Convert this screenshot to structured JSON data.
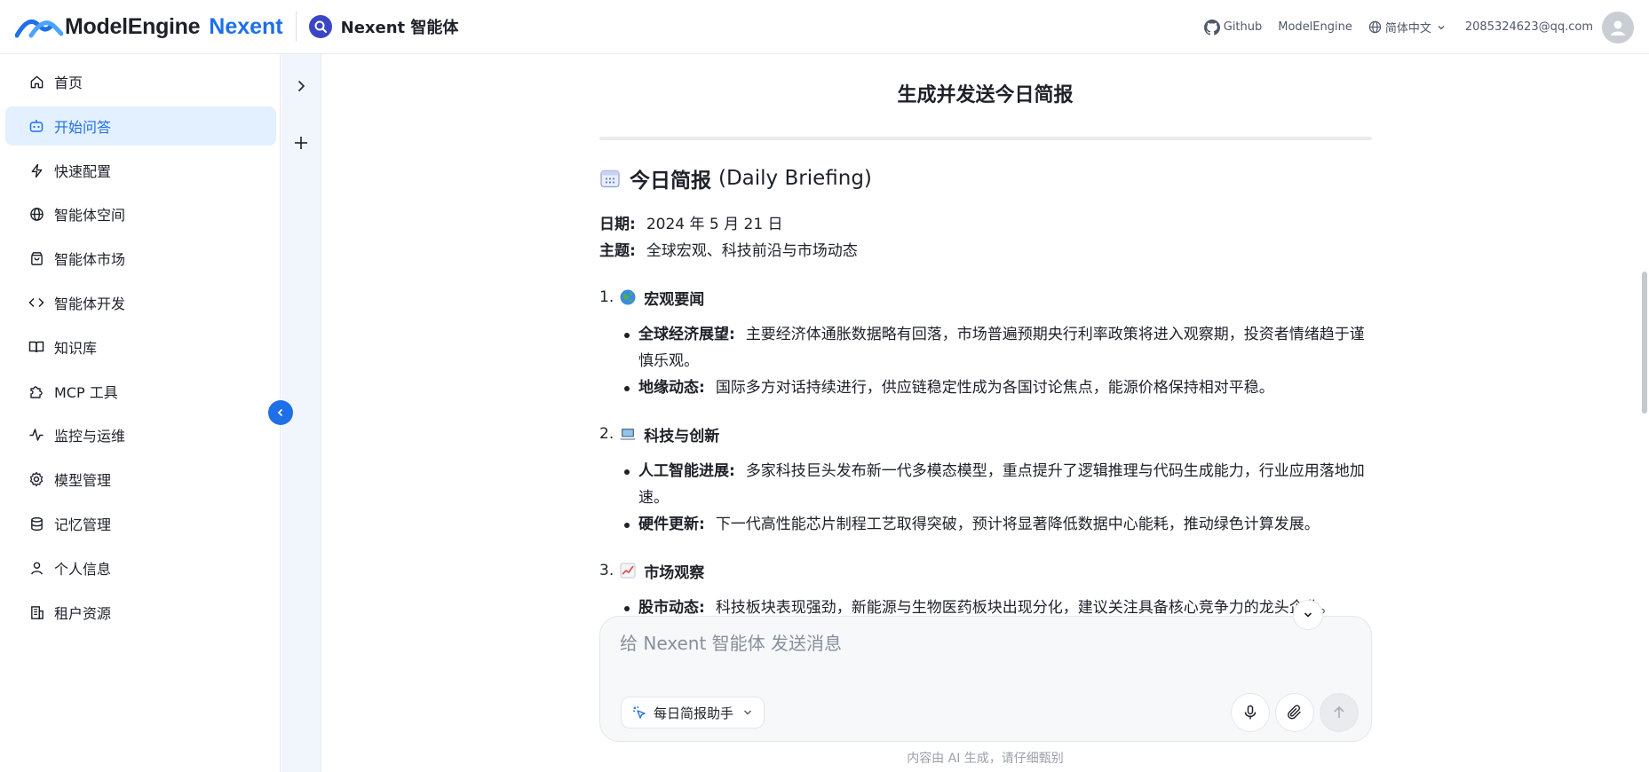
{
  "header": {
    "brand_name": "ModelEngine",
    "brand_accent": "Nexent",
    "app_title": "Nexent 智能体",
    "github_label": "Github",
    "modelengine_label": "ModelEngine",
    "language_label": "简体中文",
    "user_email": "2085324623@qq.com"
  },
  "sidebar": {
    "items": [
      {
        "label": "首页",
        "icon": "home-icon"
      },
      {
        "label": "开始问答",
        "icon": "robot-icon",
        "active": true
      },
      {
        "label": "快速配置",
        "icon": "lightning-icon"
      },
      {
        "label": "智能体空间",
        "icon": "globe-icon"
      },
      {
        "label": "智能体市场",
        "icon": "shopping-bag-icon"
      },
      {
        "label": "智能体开发",
        "icon": "code-icon"
      },
      {
        "label": "知识库",
        "icon": "book-icon"
      },
      {
        "label": "MCP 工具",
        "icon": "puzzle-icon"
      },
      {
        "label": "监控与运维",
        "icon": "activity-icon"
      },
      {
        "label": "模型管理",
        "icon": "gear-icon"
      },
      {
        "label": "记忆管理",
        "icon": "database-icon"
      },
      {
        "label": "个人信息",
        "icon": "user-icon"
      },
      {
        "label": "租户资源",
        "icon": "building-icon"
      }
    ]
  },
  "chat": {
    "title": "生成并发送今日简报",
    "briefing_title": "今日简报",
    "briefing_subtitle": "(Daily Briefing)",
    "date_label": "日期:",
    "date_value": "2024 年 5 月 21 日",
    "topic_label": "主题:",
    "topic_value": "全球宏观、科技前沿与市场动态",
    "sections": [
      {
        "number": "1.",
        "icon": "globe-emoji",
        "title": "宏观要闻",
        "bullets": [
          {
            "label": "全球经济展望:",
            "text": "主要经济体通胀数据略有回落，市场普遍预期央行利率政策将进入观察期，投资者情绪趋于谨慎乐观。"
          },
          {
            "label": "地缘动态:",
            "text": "国际多方对话持续进行，供应链稳定性成为各国讨论焦点，能源价格保持相对平稳。"
          }
        ]
      },
      {
        "number": "2.",
        "icon": "laptop-emoji",
        "title": "科技与创新",
        "bullets": [
          {
            "label": "人工智能进展:",
            "text": "多家科技巨头发布新一代多模态模型，重点提升了逻辑推理与代码生成能力，行业应用落地加速。"
          },
          {
            "label": "硬件更新:",
            "text": "下一代高性能芯片制程工艺取得突破，预计将显著降低数据中心能耗，推动绿色计算发展。"
          }
        ]
      },
      {
        "number": "3.",
        "icon": "chart-emoji",
        "title": "市场观察",
        "bullets": [
          {
            "label": "股市动态:",
            "text": "科技板块表现强劲，新能源与生物医药板块出现分化，建议关注具备核心竞争力的龙头企业。"
          }
        ]
      }
    ]
  },
  "composer": {
    "placeholder": "给 Nexent 智能体 发送消息",
    "value": "",
    "agent_name": "每日简报助手"
  },
  "footer": {
    "disclaimer": "内容由 AI 生成，请仔细甄别"
  },
  "colors": {
    "accent": "#1e6fe8",
    "active_nav_bg": "#e3f0ff",
    "rail_bg": "#f1f6fd"
  }
}
